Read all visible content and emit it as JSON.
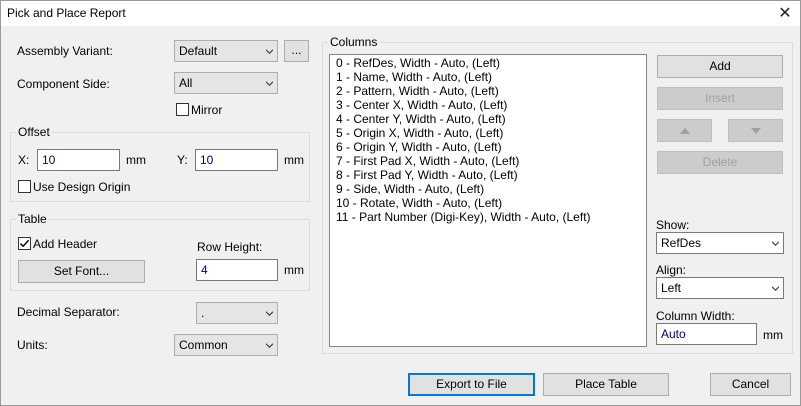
{
  "window": {
    "title": "Pick and Place Report",
    "close_glyph": "✕"
  },
  "assembly_variant": {
    "label": "Assembly Variant:",
    "value": "Default",
    "browse_label": "..."
  },
  "component_side": {
    "label": "Component Side:",
    "value": "All",
    "mirror_label": "Mirror",
    "mirror_checked": false
  },
  "offset": {
    "label": "Offset",
    "x_label": "X:",
    "x_value": "10",
    "x_unit": "mm",
    "y_label": "Y:",
    "y_value": "10",
    "y_unit": "mm",
    "use_design_origin_label": "Use Design Origin",
    "use_design_origin_checked": false
  },
  "table": {
    "label": "Table",
    "add_header_label": "Add Header",
    "add_header_checked": true,
    "set_font_label": "Set Font...",
    "row_height_label": "Row Height:",
    "row_height_value": "4",
    "row_height_unit": "mm"
  },
  "decimal_separator": {
    "label": "Decimal Separator:",
    "value": "."
  },
  "units": {
    "label": "Units:",
    "value": "Common"
  },
  "columns": {
    "label": "Columns",
    "items": [
      "0 - RefDes, Width - Auto, (Left)",
      "1 - Name, Width - Auto, (Left)",
      "2 - Pattern, Width - Auto, (Left)",
      "3 - Center X, Width - Auto, (Left)",
      "4 - Center Y, Width - Auto, (Left)",
      "5 - Origin X, Width - Auto, (Left)",
      "6 - Origin Y, Width - Auto, (Left)",
      "7 - First Pad X, Width - Auto, (Left)",
      "8 - First Pad Y, Width - Auto, (Left)",
      "9 - Side, Width - Auto, (Left)",
      "10 - Rotate, Width - Auto, (Left)",
      "11 - Part Number (Digi-Key), Width - Auto, (Left)"
    ],
    "add_label": "Add",
    "insert_label": "Insert",
    "delete_label": "Delete",
    "show_label": "Show:",
    "show_value": "RefDes",
    "align_label": "Align:",
    "align_value": "Left",
    "column_width_label": "Column Width:",
    "column_width_value": "Auto",
    "column_width_unit": "mm"
  },
  "footer": {
    "export_label": "Export to File",
    "place_table_label": "Place Table",
    "cancel_label": "Cancel"
  },
  "icons": {
    "combo_arrow": "chevron-down-icon",
    "move_up": "triangle-up-icon",
    "move_down": "triangle-down-icon",
    "check": "checkmark-icon"
  },
  "colors": {
    "accent": "#0078d7",
    "input_text": "#000080"
  }
}
